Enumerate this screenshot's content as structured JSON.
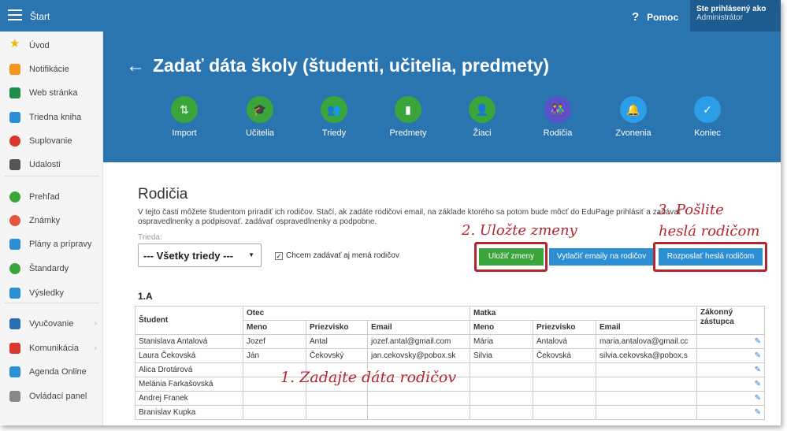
{
  "topbar": {
    "title": "Štart",
    "help_label": "Pomoc",
    "help_glyph": "?",
    "user_line1": "Ste prihlásený ako",
    "user_line2": "Administrátor"
  },
  "sidebar": {
    "items": [
      {
        "label": "Úvod",
        "icon": "star-icon",
        "color": "#f4b400"
      },
      {
        "label": "Notifikácie",
        "icon": "envelope-icon",
        "color": "#f7941d"
      },
      {
        "label": "Web stránka",
        "icon": "house-icon",
        "color": "#1f8c4a"
      },
      {
        "label": "Triedna kniha",
        "icon": "book-icon",
        "color": "#2c8fd3"
      },
      {
        "label": "Suplovanie",
        "icon": "person-icon",
        "color": "#d9372c"
      },
      {
        "label": "Udalosti",
        "icon": "calendar-icon",
        "color": "#555555"
      },
      {
        "label": "Prehľad",
        "icon": "check-circle-icon",
        "color": "#3aa53a"
      },
      {
        "label": "Známky",
        "icon": "grades-icon",
        "color": "#e8533f"
      },
      {
        "label": "Plány a prípravy",
        "icon": "briefcase-icon",
        "color": "#2c8fd3"
      },
      {
        "label": "Štandardy",
        "icon": "shield-check-icon",
        "color": "#3aa53a"
      },
      {
        "label": "Výsledky",
        "icon": "bar-chart-icon",
        "color": "#2c8fd3"
      },
      {
        "label": "Vyučovanie",
        "icon": "teacher-icon",
        "color": "#2c6fb0"
      },
      {
        "label": "Komunikácia",
        "icon": "chat-icon",
        "color": "#d9372c"
      },
      {
        "label": "Agenda Online",
        "icon": "pencil-icon",
        "color": "#2c8fd3"
      },
      {
        "label": "Ovládací panel",
        "icon": "gear-icon",
        "color": "#888888"
      }
    ]
  },
  "header": {
    "title": "Zadať dáta školy (študenti, učitelia, predmety)"
  },
  "steps": [
    {
      "label": "Import",
      "color": "#3aa53a",
      "glyph": "⇅",
      "icon": "import-icon"
    },
    {
      "label": "Učitelia",
      "color": "#3aa53a",
      "glyph": "🎓",
      "icon": "graduation-cap-icon"
    },
    {
      "label": "Triedy",
      "color": "#3aa53a",
      "glyph": "👥",
      "icon": "group-icon"
    },
    {
      "label": "Predmety",
      "color": "#3aa53a",
      "glyph": "▮",
      "icon": "book-icon"
    },
    {
      "label": "Žiaci",
      "color": "#3aa53a",
      "glyph": "👤",
      "icon": "student-icon"
    },
    {
      "label": "Rodičia",
      "color": "#5b51c8",
      "glyph": "👫",
      "icon": "parents-icon"
    },
    {
      "label": "Zvonenia",
      "color": "#2c9ee8",
      "glyph": "🔔",
      "icon": "bell-icon"
    },
    {
      "label": "Koniec",
      "color": "#2c9ee8",
      "glyph": "✓",
      "icon": "checkmark-icon"
    }
  ],
  "main": {
    "heading": "Rodičia",
    "intro": "V tejto časti môžete študentom priradiť ich rodičov. Stačí, ak zadáte rodičovi email, na základe ktorého sa potom bude môcť do EduPage prihlásiť a zadávať ospravedlnenky a podpisovať. zadávať ospravedlnenky a podpobne.",
    "class_label": "Trieda:",
    "class_value": "--- Všetky triedy ---",
    "checkbox_label": "Chcem zadávať aj mená rodičov",
    "btn_save": "Uložiť zmeny",
    "btn_print": "Vytlačiť emaily na rodičov",
    "btn_send": "Rozposlať heslá rodičom",
    "class_heading": "1.A"
  },
  "annotations": {
    "a1": "1. Zadajte dáta rodičov",
    "a2": "2. Uložte zmeny",
    "a3_line1": "3. Pošlite",
    "a3_line2": "heslá rodičom",
    "color": "#b3262e"
  },
  "table": {
    "headers": {
      "student": "Študent",
      "father": "Otec",
      "mother": "Matka",
      "guardian": "Zákonný zástupca",
      "name": "Meno",
      "surname": "Priezvisko",
      "email": "Email"
    },
    "rows": [
      {
        "student": "Stanislava Antalová",
        "f_name": "Jozef",
        "f_surname": "Antal",
        "f_email": "jozef.antal@gmail.com",
        "m_name": "Mária",
        "m_surname": "Antalová",
        "m_email": "maria.antalova@gmail.cc"
      },
      {
        "student": "Laura Čekovská",
        "f_name": "Ján",
        "f_surname": "Čekovský",
        "f_email": "jan.cekovsky@pobox.sk",
        "m_name": "Silvia",
        "m_surname": "Čekovská",
        "m_email": "silvia.cekovska@pobox.s"
      },
      {
        "student": "Alica Drotárová",
        "f_name": "",
        "f_surname": "",
        "f_email": "",
        "m_name": "",
        "m_surname": "",
        "m_email": ""
      },
      {
        "student": "Melánia Farkašovská",
        "f_name": "",
        "f_surname": "",
        "f_email": "",
        "m_name": "",
        "m_surname": "",
        "m_email": ""
      },
      {
        "student": "Andrej Franek",
        "f_name": "",
        "f_surname": "",
        "f_email": "",
        "m_name": "",
        "m_surname": "",
        "m_email": ""
      },
      {
        "student": "Branislav Kupka",
        "f_name": "",
        "f_surname": "",
        "f_email": "",
        "m_name": "",
        "m_surname": "",
        "m_email": ""
      }
    ]
  }
}
